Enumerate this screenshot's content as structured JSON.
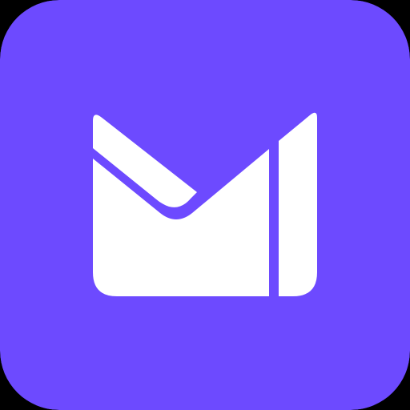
{
  "app_icon": {
    "icon_name": "envelope-mail-icon",
    "colors": {
      "tile": "#6D4AFF",
      "glyph": "#FFFFFF",
      "outer_background": "#000000"
    }
  }
}
